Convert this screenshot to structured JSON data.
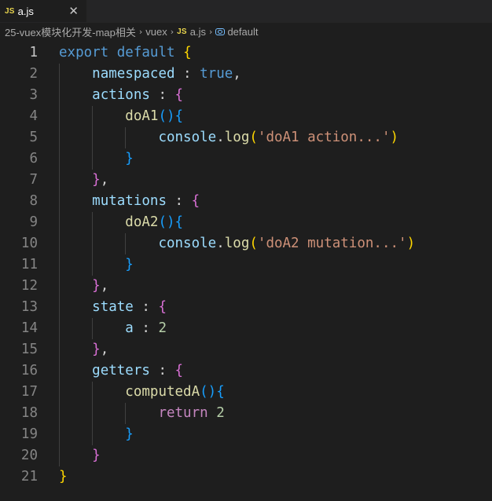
{
  "tab": {
    "icon": "JS",
    "label": "a.js"
  },
  "breadcrumb": {
    "folder": "25-vuex模块化开发-map相关",
    "subfolder": "vuex",
    "file_icon": "JS",
    "file": "a.js",
    "symbol": "default"
  },
  "colors": {
    "background": "#1e1e1e",
    "keyword": "#569cd6",
    "control": "#c586c0",
    "property": "#9cdcfe",
    "function": "#dcdcaa",
    "string": "#ce9178",
    "number": "#b5cea8",
    "bracket1": "#ffd700",
    "bracket2": "#da70d6",
    "bracket3": "#179fff"
  },
  "code": {
    "lines": [
      [
        {
          "t": "export",
          "c": "kw"
        },
        {
          "t": " ",
          "c": "plain"
        },
        {
          "t": "default",
          "c": "kw"
        },
        {
          "t": " ",
          "c": "plain"
        },
        {
          "t": "{",
          "c": "p1"
        }
      ],
      [
        {
          "t": "    ",
          "c": "plain"
        },
        {
          "t": "namespaced",
          "c": "prop"
        },
        {
          "t": " : ",
          "c": "plain"
        },
        {
          "t": "true",
          "c": "kw"
        },
        {
          "t": ",",
          "c": "plain"
        }
      ],
      [
        {
          "t": "    ",
          "c": "plain"
        },
        {
          "t": "actions",
          "c": "prop"
        },
        {
          "t": " : ",
          "c": "plain"
        },
        {
          "t": "{",
          "c": "p2"
        }
      ],
      [
        {
          "t": "        ",
          "c": "plain"
        },
        {
          "t": "doA1",
          "c": "fn"
        },
        {
          "t": "()",
          "c": "p3"
        },
        {
          "t": "{",
          "c": "p3"
        }
      ],
      [
        {
          "t": "            ",
          "c": "plain"
        },
        {
          "t": "console",
          "c": "prop"
        },
        {
          "t": ".",
          "c": "plain"
        },
        {
          "t": "log",
          "c": "fn"
        },
        {
          "t": "(",
          "c": "p1"
        },
        {
          "t": "'doA1 action...'",
          "c": "str"
        },
        {
          "t": ")",
          "c": "p1"
        }
      ],
      [
        {
          "t": "        ",
          "c": "plain"
        },
        {
          "t": "}",
          "c": "p3"
        }
      ],
      [
        {
          "t": "    ",
          "c": "plain"
        },
        {
          "t": "}",
          "c": "p2"
        },
        {
          "t": ",",
          "c": "plain"
        }
      ],
      [
        {
          "t": "    ",
          "c": "plain"
        },
        {
          "t": "mutations",
          "c": "prop"
        },
        {
          "t": " : ",
          "c": "plain"
        },
        {
          "t": "{",
          "c": "p2"
        }
      ],
      [
        {
          "t": "        ",
          "c": "plain"
        },
        {
          "t": "doA2",
          "c": "fn"
        },
        {
          "t": "()",
          "c": "p3"
        },
        {
          "t": "{",
          "c": "p3"
        }
      ],
      [
        {
          "t": "            ",
          "c": "plain"
        },
        {
          "t": "console",
          "c": "prop"
        },
        {
          "t": ".",
          "c": "plain"
        },
        {
          "t": "log",
          "c": "fn"
        },
        {
          "t": "(",
          "c": "p1"
        },
        {
          "t": "'doA2 mutation...'",
          "c": "str"
        },
        {
          "t": ")",
          "c": "p1"
        }
      ],
      [
        {
          "t": "        ",
          "c": "plain"
        },
        {
          "t": "}",
          "c": "p3"
        }
      ],
      [
        {
          "t": "    ",
          "c": "plain"
        },
        {
          "t": "}",
          "c": "p2"
        },
        {
          "t": ",",
          "c": "plain"
        }
      ],
      [
        {
          "t": "    ",
          "c": "plain"
        },
        {
          "t": "state",
          "c": "prop"
        },
        {
          "t": " : ",
          "c": "plain"
        },
        {
          "t": "{",
          "c": "p2"
        }
      ],
      [
        {
          "t": "        ",
          "c": "plain"
        },
        {
          "t": "a",
          "c": "prop"
        },
        {
          "t": " : ",
          "c": "plain"
        },
        {
          "t": "2",
          "c": "num"
        }
      ],
      [
        {
          "t": "    ",
          "c": "plain"
        },
        {
          "t": "}",
          "c": "p2"
        },
        {
          "t": ",",
          "c": "plain"
        }
      ],
      [
        {
          "t": "    ",
          "c": "plain"
        },
        {
          "t": "getters",
          "c": "prop"
        },
        {
          "t": " : ",
          "c": "plain"
        },
        {
          "t": "{",
          "c": "p2"
        }
      ],
      [
        {
          "t": "        ",
          "c": "plain"
        },
        {
          "t": "computedA",
          "c": "fn"
        },
        {
          "t": "()",
          "c": "p3"
        },
        {
          "t": "{",
          "c": "p3"
        }
      ],
      [
        {
          "t": "            ",
          "c": "plain"
        },
        {
          "t": "return",
          "c": "kw2"
        },
        {
          "t": " ",
          "c": "plain"
        },
        {
          "t": "2",
          "c": "num"
        }
      ],
      [
        {
          "t": "        ",
          "c": "plain"
        },
        {
          "t": "}",
          "c": "p3"
        }
      ],
      [
        {
          "t": "    ",
          "c": "plain"
        },
        {
          "t": "}",
          "c": "p2"
        }
      ],
      [
        {
          "t": "}",
          "c": "p1"
        }
      ]
    ]
  }
}
